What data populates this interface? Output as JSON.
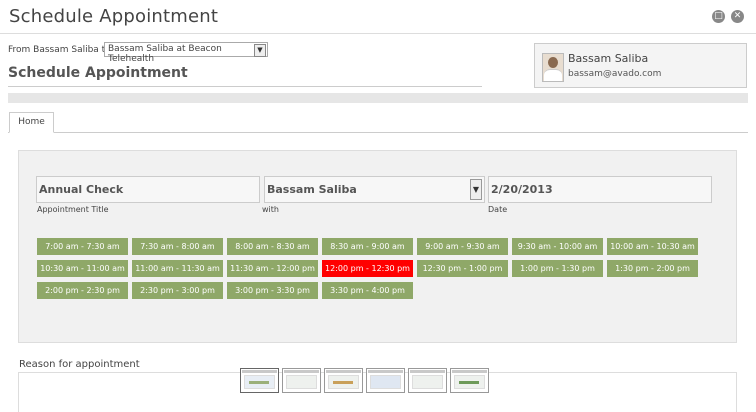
{
  "window": {
    "title": "Schedule Appointment",
    "minimize_icon": "restore-icon",
    "close_icon": "close-icon"
  },
  "header": {
    "from_label": "From Bassam Saliba to",
    "recipient_selected": "Bassam Saliba at Beacon Telehealth",
    "page_title": "Schedule Appointment"
  },
  "profile": {
    "name": "Bassam Saliba",
    "email": "bassam@avado.com",
    "avatar_icon": "user-photo"
  },
  "tabs": [
    {
      "label": "Home"
    }
  ],
  "form": {
    "title_value": "Annual Check",
    "title_label": "Appointment Title",
    "with_value": "Bassam Saliba",
    "with_label": "with",
    "date_value": "2/20/2013",
    "date_label": "Date"
  },
  "time_slots": [
    {
      "label": "7:00 am - 7:30 am",
      "selected": false
    },
    {
      "label": "7:30 am - 8:00 am",
      "selected": false
    },
    {
      "label": "8:00 am - 8:30 am",
      "selected": false
    },
    {
      "label": "8:30 am - 9:00 am",
      "selected": false
    },
    {
      "label": "9:00 am - 9:30 am",
      "selected": false
    },
    {
      "label": "9:30 am - 10:00 am",
      "selected": false
    },
    {
      "label": "10:00 am - 10:30 am",
      "selected": false
    },
    {
      "label": "10:30 am - 11:00 am",
      "selected": false
    },
    {
      "label": "11:00 am - 11:30 am",
      "selected": false
    },
    {
      "label": "11:30 am - 12:00 pm",
      "selected": false
    },
    {
      "label": "12:00 pm - 12:30 pm",
      "selected": true
    },
    {
      "label": "12:30 pm - 1:00 pm",
      "selected": false
    },
    {
      "label": "1:00 pm - 1:30 pm",
      "selected": false
    },
    {
      "label": "1:30 pm - 2:00 pm",
      "selected": false
    },
    {
      "label": "2:00 pm - 2:30 pm",
      "selected": false
    },
    {
      "label": "2:30 pm - 3:00 pm",
      "selected": false
    },
    {
      "label": "3:00 pm - 3:30 pm",
      "selected": false
    },
    {
      "label": "3:30 pm - 4:00 pm",
      "selected": false
    }
  ],
  "reason": {
    "label": "Reason for appointment"
  },
  "colors": {
    "slot_available": "#8fa868",
    "slot_selected": "#ff0000"
  }
}
